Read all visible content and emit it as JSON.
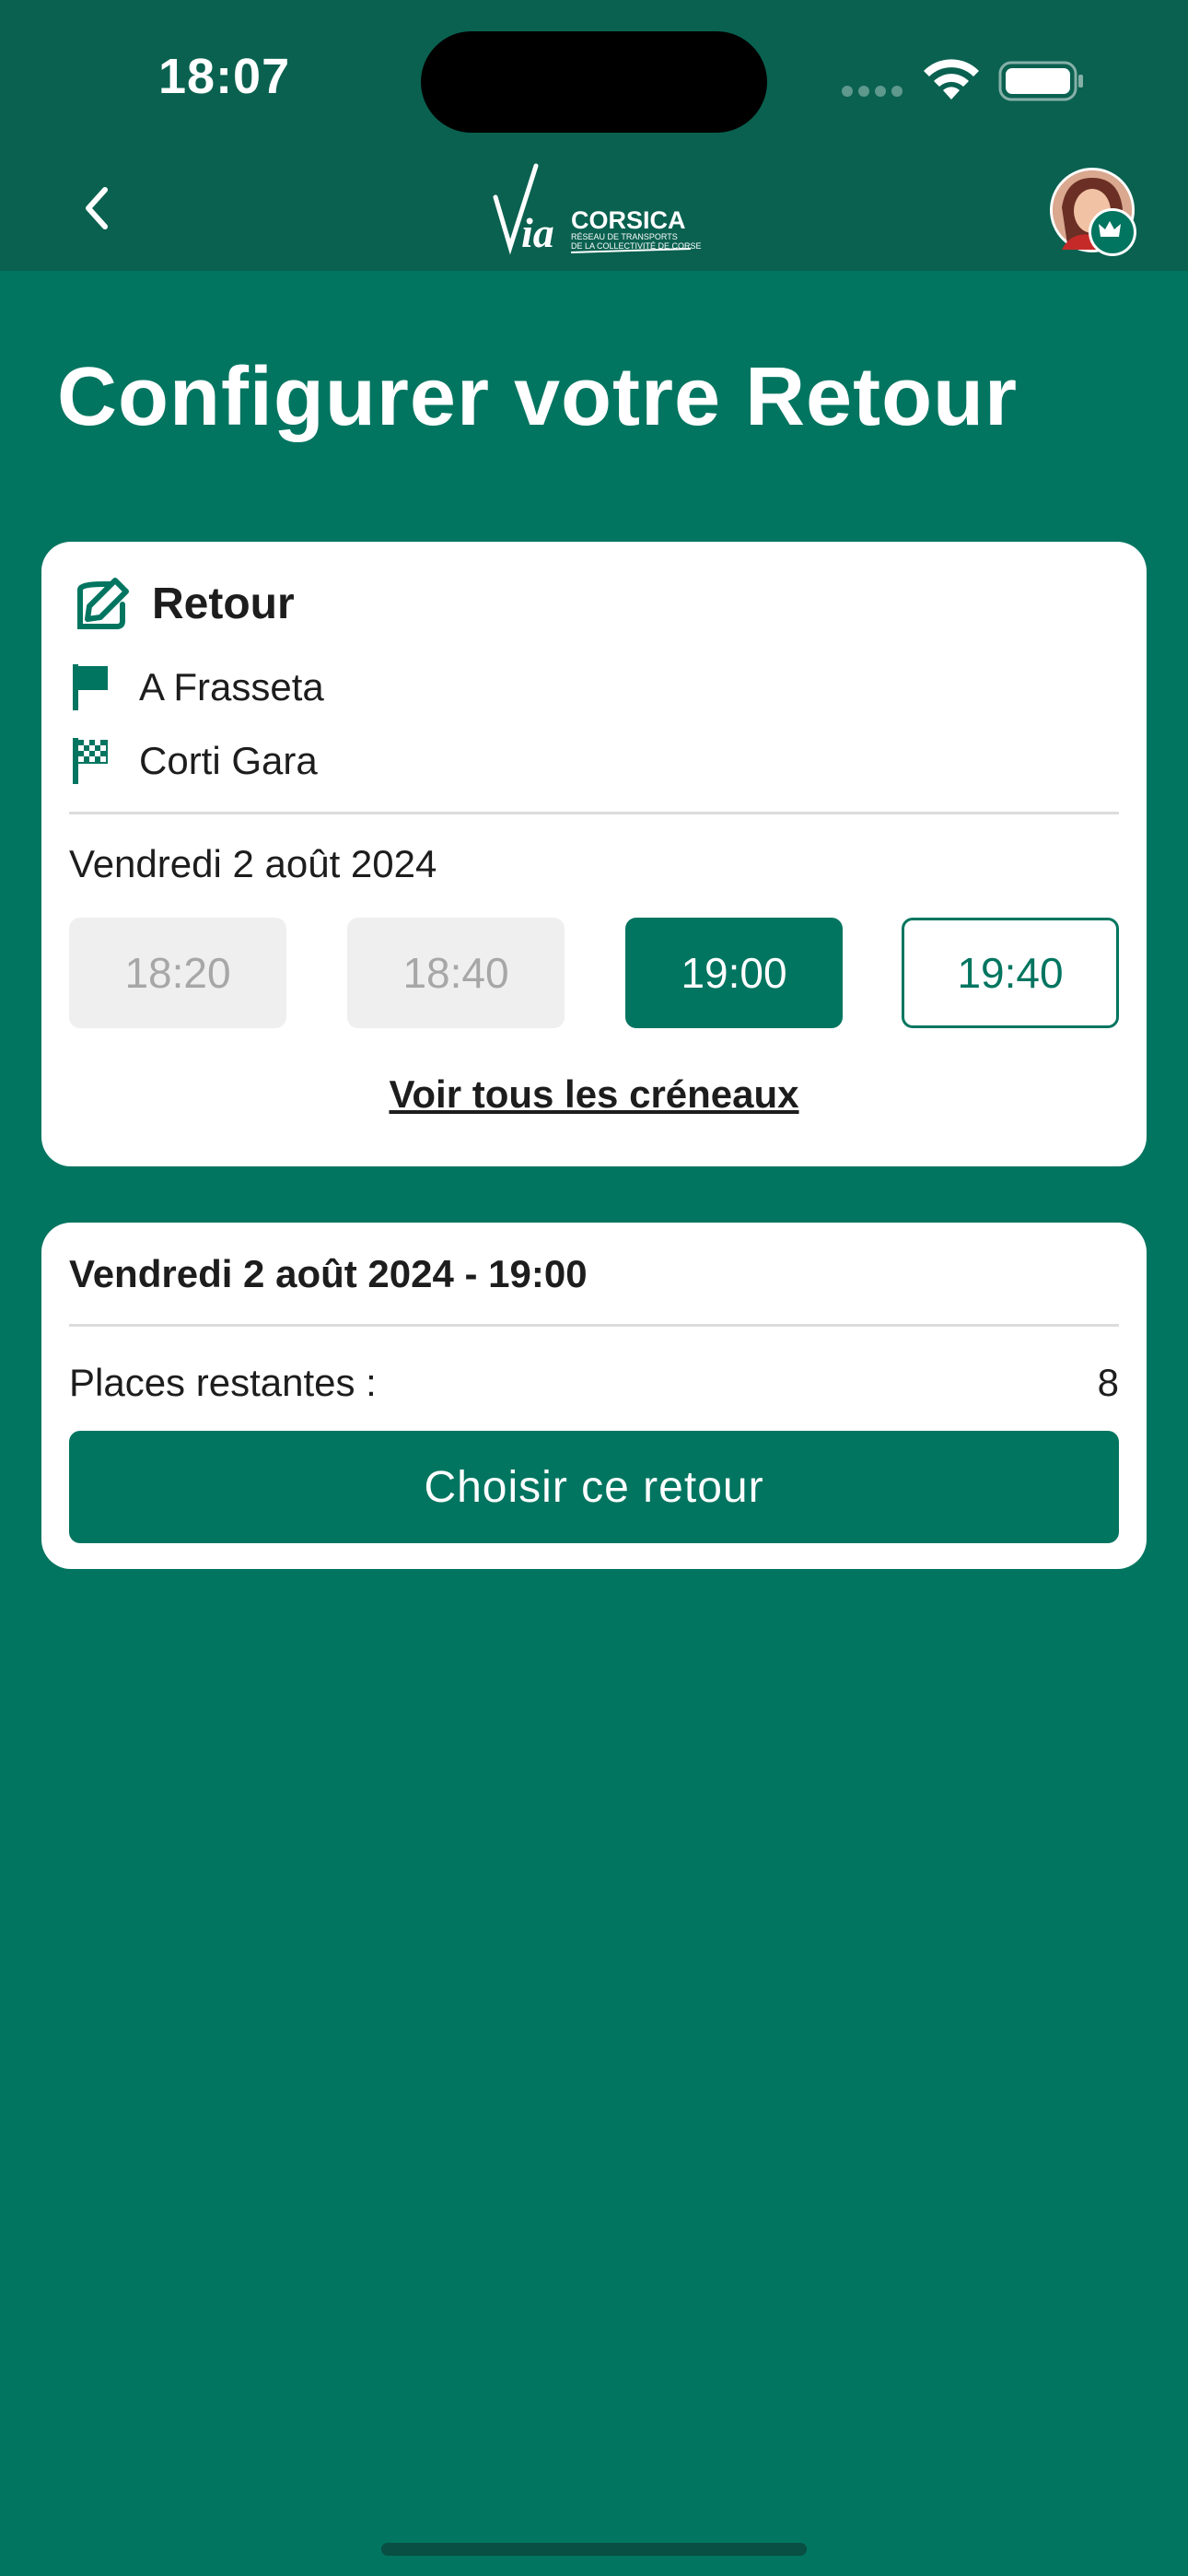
{
  "status_bar": {
    "time": "18:07"
  },
  "header": {
    "logo_main": "Via",
    "logo_brand": "CORSICA",
    "logo_sub1": "RÉSEAU DE TRANSPORTS",
    "logo_sub2": "DE LA COLLECTIVITÉ DE CORSE"
  },
  "page": {
    "title": "Configurer votre Retour"
  },
  "trip_card": {
    "heading": "Retour",
    "departure": "A Frasseta",
    "arrival": "Corti Gara",
    "date": "Vendredi 2 août 2024",
    "slots": [
      {
        "time": "18:20",
        "state": "disabled"
      },
      {
        "time": "18:40",
        "state": "disabled"
      },
      {
        "time": "19:00",
        "state": "selected"
      },
      {
        "time": "19:40",
        "state": "available"
      }
    ],
    "see_all_label": "Voir tous les créneaux"
  },
  "summary_card": {
    "title": "Vendredi 2 août 2024 - 19:00",
    "places_label": "Places restantes :",
    "places_value": "8",
    "choose_label": "Choisir ce retour"
  },
  "colors": {
    "primary": "#017560",
    "header_bg": "#0a6150",
    "disabled_bg": "#efefef"
  },
  "icons": {
    "back": "chevron-left-icon",
    "edit": "edit-square-icon",
    "departure": "flag-icon",
    "arrival": "checkered-flag-icon"
  }
}
